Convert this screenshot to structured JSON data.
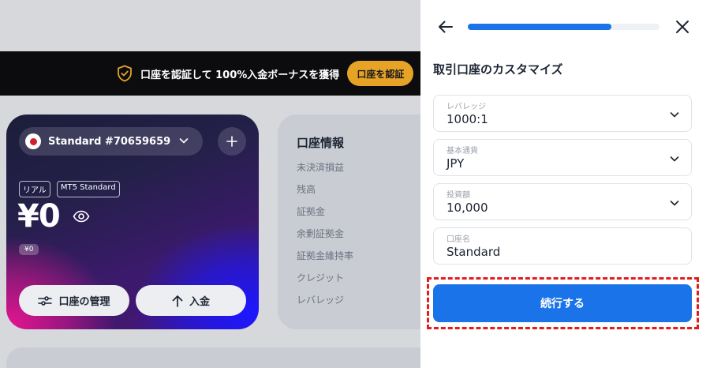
{
  "banner": {
    "text": "口座を認証して 100%入金ボーナスを獲得",
    "button_label": "口座を認証",
    "icon": "shield-check-icon"
  },
  "account_card": {
    "account_name": "Standard #70659659",
    "tags": [
      "リアル",
      "MT5 Standard"
    ],
    "balance": "¥0",
    "sub_balance": "¥0",
    "manage_label": "口座の管理",
    "deposit_label": "入金"
  },
  "account_info": {
    "title": "口座情報",
    "rows": [
      "未決済損益",
      "残高",
      "証拠金",
      "余剰証拠金",
      "証拠金維持率",
      "クレジット",
      "レバレッジ"
    ]
  },
  "panel": {
    "progress": 0.75,
    "title": "取引口座のカスタマイズ",
    "fields": [
      {
        "label": "レバレッジ",
        "value": "1000:1"
      },
      {
        "label": "基本通貨",
        "value": "JPY"
      },
      {
        "label": "投資額",
        "value": "10,000"
      },
      {
        "label": "口座名",
        "value": "Standard"
      }
    ],
    "continue_label": "続行する"
  },
  "colors": {
    "accent": "#1a73e8",
    "banner_button": "#e6a326",
    "highlight": "#e31b1b"
  }
}
